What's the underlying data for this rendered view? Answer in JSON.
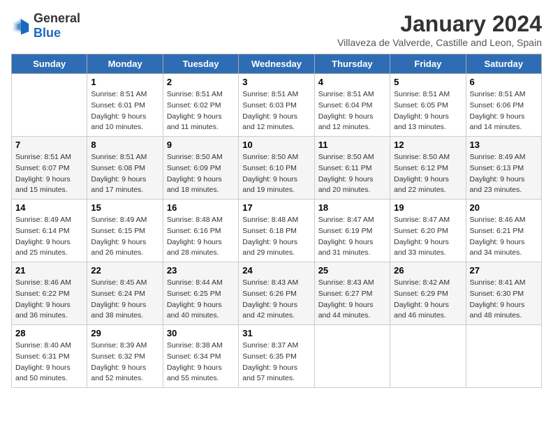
{
  "logo": {
    "general": "General",
    "blue": "Blue"
  },
  "title": "January 2024",
  "subtitle": "Villaveza de Valverde, Castille and Leon, Spain",
  "weekdays": [
    "Sunday",
    "Monday",
    "Tuesday",
    "Wednesday",
    "Thursday",
    "Friday",
    "Saturday"
  ],
  "weeks": [
    [
      {
        "day": "",
        "sunrise": "",
        "sunset": "",
        "daylight": ""
      },
      {
        "day": "1",
        "sunrise": "Sunrise: 8:51 AM",
        "sunset": "Sunset: 6:01 PM",
        "daylight": "Daylight: 9 hours and 10 minutes."
      },
      {
        "day": "2",
        "sunrise": "Sunrise: 8:51 AM",
        "sunset": "Sunset: 6:02 PM",
        "daylight": "Daylight: 9 hours and 11 minutes."
      },
      {
        "day": "3",
        "sunrise": "Sunrise: 8:51 AM",
        "sunset": "Sunset: 6:03 PM",
        "daylight": "Daylight: 9 hours and 12 minutes."
      },
      {
        "day": "4",
        "sunrise": "Sunrise: 8:51 AM",
        "sunset": "Sunset: 6:04 PM",
        "daylight": "Daylight: 9 hours and 12 minutes."
      },
      {
        "day": "5",
        "sunrise": "Sunrise: 8:51 AM",
        "sunset": "Sunset: 6:05 PM",
        "daylight": "Daylight: 9 hours and 13 minutes."
      },
      {
        "day": "6",
        "sunrise": "Sunrise: 8:51 AM",
        "sunset": "Sunset: 6:06 PM",
        "daylight": "Daylight: 9 hours and 14 minutes."
      }
    ],
    [
      {
        "day": "7",
        "sunrise": "Sunrise: 8:51 AM",
        "sunset": "Sunset: 6:07 PM",
        "daylight": "Daylight: 9 hours and 15 minutes."
      },
      {
        "day": "8",
        "sunrise": "Sunrise: 8:51 AM",
        "sunset": "Sunset: 6:08 PM",
        "daylight": "Daylight: 9 hours and 17 minutes."
      },
      {
        "day": "9",
        "sunrise": "Sunrise: 8:50 AM",
        "sunset": "Sunset: 6:09 PM",
        "daylight": "Daylight: 9 hours and 18 minutes."
      },
      {
        "day": "10",
        "sunrise": "Sunrise: 8:50 AM",
        "sunset": "Sunset: 6:10 PM",
        "daylight": "Daylight: 9 hours and 19 minutes."
      },
      {
        "day": "11",
        "sunrise": "Sunrise: 8:50 AM",
        "sunset": "Sunset: 6:11 PM",
        "daylight": "Daylight: 9 hours and 20 minutes."
      },
      {
        "day": "12",
        "sunrise": "Sunrise: 8:50 AM",
        "sunset": "Sunset: 6:12 PM",
        "daylight": "Daylight: 9 hours and 22 minutes."
      },
      {
        "day": "13",
        "sunrise": "Sunrise: 8:49 AM",
        "sunset": "Sunset: 6:13 PM",
        "daylight": "Daylight: 9 hours and 23 minutes."
      }
    ],
    [
      {
        "day": "14",
        "sunrise": "Sunrise: 8:49 AM",
        "sunset": "Sunset: 6:14 PM",
        "daylight": "Daylight: 9 hours and 25 minutes."
      },
      {
        "day": "15",
        "sunrise": "Sunrise: 8:49 AM",
        "sunset": "Sunset: 6:15 PM",
        "daylight": "Daylight: 9 hours and 26 minutes."
      },
      {
        "day": "16",
        "sunrise": "Sunrise: 8:48 AM",
        "sunset": "Sunset: 6:16 PM",
        "daylight": "Daylight: 9 hours and 28 minutes."
      },
      {
        "day": "17",
        "sunrise": "Sunrise: 8:48 AM",
        "sunset": "Sunset: 6:18 PM",
        "daylight": "Daylight: 9 hours and 29 minutes."
      },
      {
        "day": "18",
        "sunrise": "Sunrise: 8:47 AM",
        "sunset": "Sunset: 6:19 PM",
        "daylight": "Daylight: 9 hours and 31 minutes."
      },
      {
        "day": "19",
        "sunrise": "Sunrise: 8:47 AM",
        "sunset": "Sunset: 6:20 PM",
        "daylight": "Daylight: 9 hours and 33 minutes."
      },
      {
        "day": "20",
        "sunrise": "Sunrise: 8:46 AM",
        "sunset": "Sunset: 6:21 PM",
        "daylight": "Daylight: 9 hours and 34 minutes."
      }
    ],
    [
      {
        "day": "21",
        "sunrise": "Sunrise: 8:46 AM",
        "sunset": "Sunset: 6:22 PM",
        "daylight": "Daylight: 9 hours and 36 minutes."
      },
      {
        "day": "22",
        "sunrise": "Sunrise: 8:45 AM",
        "sunset": "Sunset: 6:24 PM",
        "daylight": "Daylight: 9 hours and 38 minutes."
      },
      {
        "day": "23",
        "sunrise": "Sunrise: 8:44 AM",
        "sunset": "Sunset: 6:25 PM",
        "daylight": "Daylight: 9 hours and 40 minutes."
      },
      {
        "day": "24",
        "sunrise": "Sunrise: 8:43 AM",
        "sunset": "Sunset: 6:26 PM",
        "daylight": "Daylight: 9 hours and 42 minutes."
      },
      {
        "day": "25",
        "sunrise": "Sunrise: 8:43 AM",
        "sunset": "Sunset: 6:27 PM",
        "daylight": "Daylight: 9 hours and 44 minutes."
      },
      {
        "day": "26",
        "sunrise": "Sunrise: 8:42 AM",
        "sunset": "Sunset: 6:29 PM",
        "daylight": "Daylight: 9 hours and 46 minutes."
      },
      {
        "day": "27",
        "sunrise": "Sunrise: 8:41 AM",
        "sunset": "Sunset: 6:30 PM",
        "daylight": "Daylight: 9 hours and 48 minutes."
      }
    ],
    [
      {
        "day": "28",
        "sunrise": "Sunrise: 8:40 AM",
        "sunset": "Sunset: 6:31 PM",
        "daylight": "Daylight: 9 hours and 50 minutes."
      },
      {
        "day": "29",
        "sunrise": "Sunrise: 8:39 AM",
        "sunset": "Sunset: 6:32 PM",
        "daylight": "Daylight: 9 hours and 52 minutes."
      },
      {
        "day": "30",
        "sunrise": "Sunrise: 8:38 AM",
        "sunset": "Sunset: 6:34 PM",
        "daylight": "Daylight: 9 hours and 55 minutes."
      },
      {
        "day": "31",
        "sunrise": "Sunrise: 8:37 AM",
        "sunset": "Sunset: 6:35 PM",
        "daylight": "Daylight: 9 hours and 57 minutes."
      },
      {
        "day": "",
        "sunrise": "",
        "sunset": "",
        "daylight": ""
      },
      {
        "day": "",
        "sunrise": "",
        "sunset": "",
        "daylight": ""
      },
      {
        "day": "",
        "sunrise": "",
        "sunset": "",
        "daylight": ""
      }
    ]
  ]
}
